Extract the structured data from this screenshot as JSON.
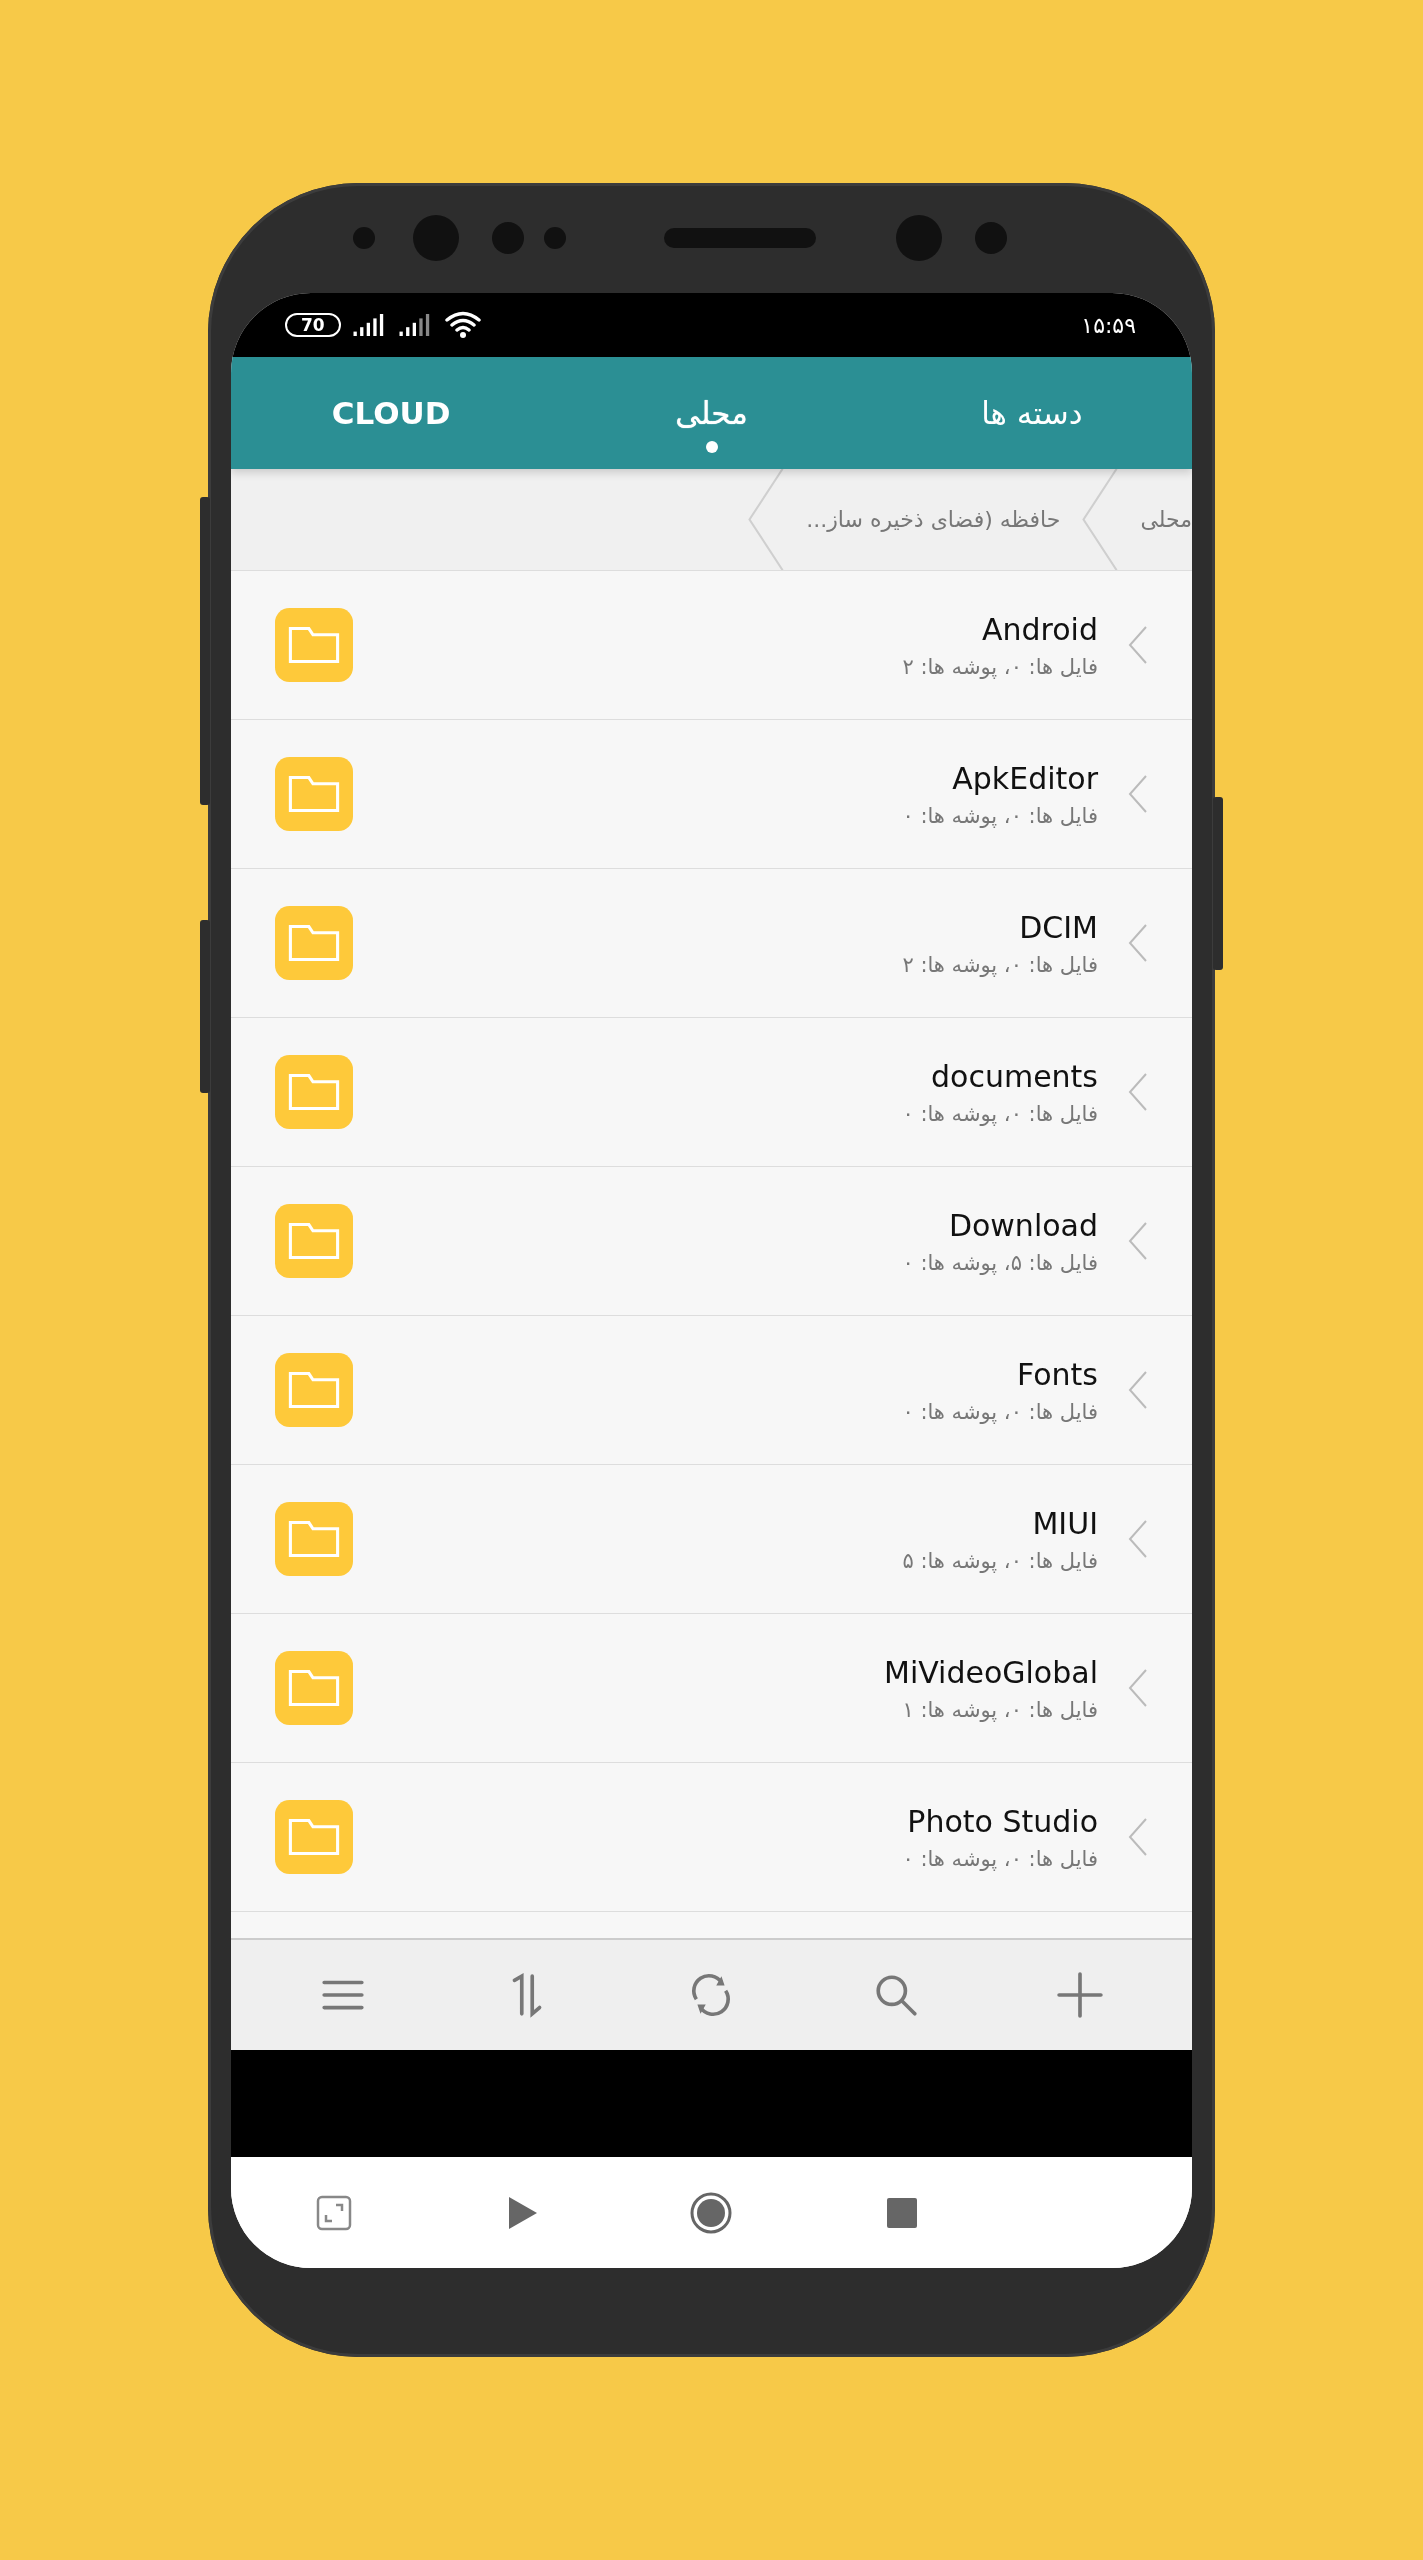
{
  "status_bar": {
    "battery": "70",
    "time": "۱۵:۵۹"
  },
  "tabs": [
    {
      "label": "دسته ها",
      "selected": false
    },
    {
      "label": "محلی",
      "selected": true
    },
    {
      "label": "CLOUD",
      "selected": false
    }
  ],
  "breadcrumb": [
    "محلی",
    "حافظه (فضای ذخیره ساز..."
  ],
  "folders": [
    {
      "name": "Android",
      "info": "فایل ها: ۰، پوشه ها: ۲"
    },
    {
      "name": "ApkEditor",
      "info": "فایل ها: ۰، پوشه ها: ۰"
    },
    {
      "name": "DCIM",
      "info": "فایل ها: ۰، پوشه ها: ۲"
    },
    {
      "name": "documents",
      "info": "فایل ها: ۰، پوشه ها: ۰"
    },
    {
      "name": "Download",
      "info": "فایل ها: ۵، پوشه ها: ۰"
    },
    {
      "name": "Fonts",
      "info": "فایل ها: ۰، پوشه ها: ۰"
    },
    {
      "name": "MIUI",
      "info": "فایل ها: ۰، پوشه ها: ۵"
    },
    {
      "name": "MiVideoGlobal",
      "info": "فایل ها: ۰، پوشه ها: ۱"
    },
    {
      "name": "Photo Studio",
      "info": "فایل ها: ۰، پوشه ها: ۰"
    }
  ]
}
